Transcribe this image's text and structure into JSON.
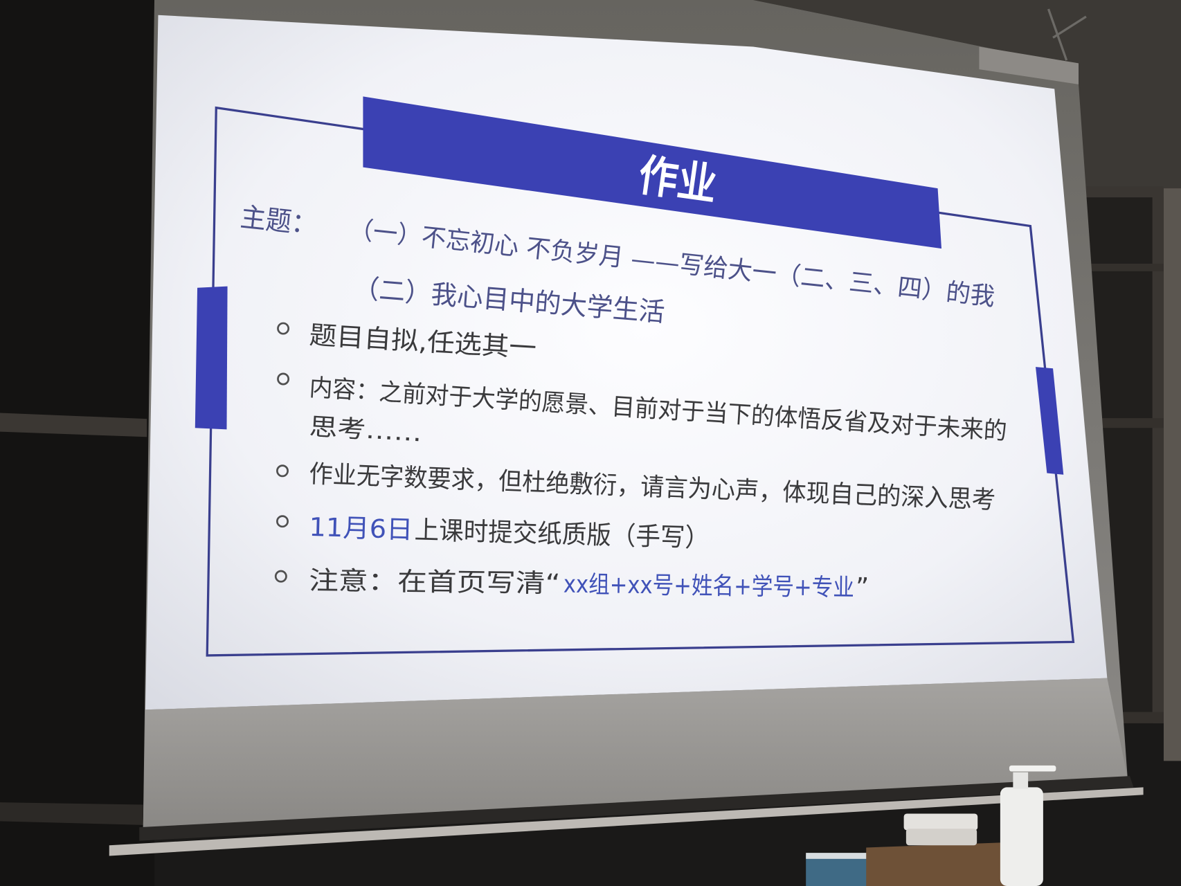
{
  "slide": {
    "title": "作业",
    "topic_label": "主题：",
    "topics": [
      "（一）不忘初心  不负岁月 ——写给大一（二、三、四）的我",
      "（二）我心目中的大学生活"
    ],
    "bullets": [
      {
        "text": "题目自拟,任选其一"
      },
      {
        "lines": [
          "内容：之前对于大学的愿景、目前对于当下的体悟反省及对于未来的",
          "思考……"
        ]
      },
      {
        "text": "作业无字数要求，但杜绝敷衍，请言为心声，体现自己的深入思考"
      },
      {
        "highlight": "11月6日",
        "text": "上课时提交纸质版（手写）"
      },
      {
        "text": "注意：在首页写清“",
        "highlight": "xx组+xx号+姓名+学号+专业",
        "suffix": "”"
      }
    ]
  },
  "colors": {
    "title_band": "#3b41b3",
    "title_text": "#ffffff",
    "topic_text": "#4c5189",
    "body_text": "#3a3a3c",
    "highlight_text": "#4052b8",
    "frame": "#3a3f8e"
  }
}
